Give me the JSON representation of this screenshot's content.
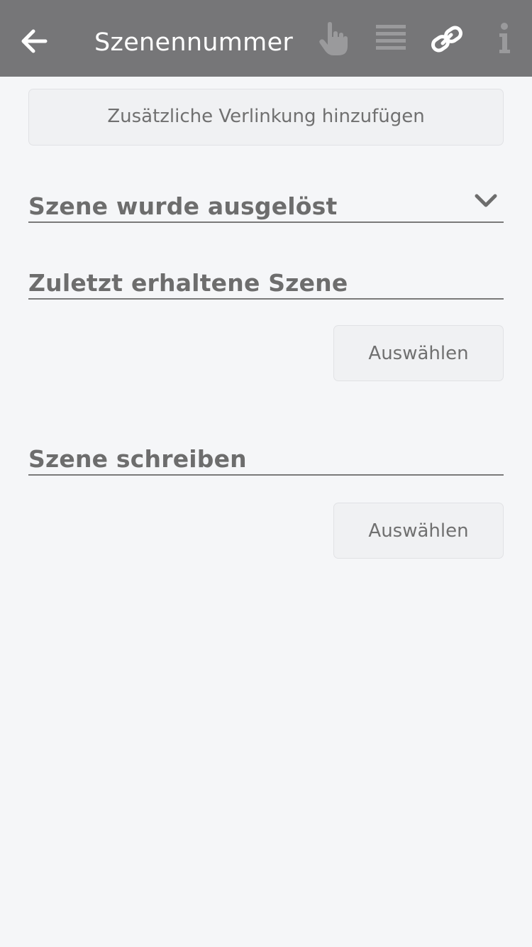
{
  "header": {
    "title": "Szenennummer",
    "icons": [
      "back-arrow-icon",
      "hand-pointer-icon",
      "list-lines-icon",
      "link-icon",
      "info-icon"
    ]
  },
  "main": {
    "add_link_label": "Zusätzliche Verlinkung hinzufügen",
    "sections": [
      {
        "title": "Szene wurde ausgelöst",
        "has_dropdown": true
      },
      {
        "title": "Zuletzt erhaltene Szene",
        "button_label": "Auswählen"
      },
      {
        "title": "Szene schreiben",
        "button_label": "Auswählen"
      }
    ]
  },
  "colors": {
    "header_bg": "#767678",
    "page_bg": "#f5f6f8",
    "button_bg": "#f0f1f3",
    "text_gray": "#6d6d6d"
  }
}
